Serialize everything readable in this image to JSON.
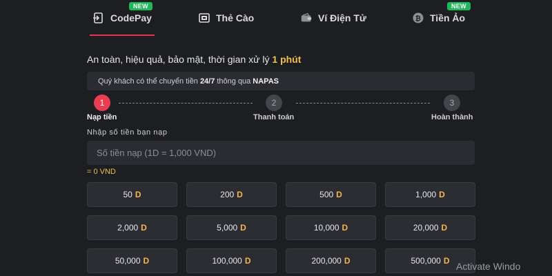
{
  "tabs": [
    {
      "label": "CodePay",
      "icon": "codepay-icon",
      "badge": "NEW",
      "active": true
    },
    {
      "label": "Thẻ Cào",
      "icon": "card-icon",
      "badge": "",
      "active": false
    },
    {
      "label": "Ví Điện Tử",
      "icon": "wallet-icon",
      "badge": "",
      "active": false
    },
    {
      "label": "Tiền Ảo",
      "icon": "bitcoin-icon",
      "badge": "NEW",
      "active": false
    }
  ],
  "headline": {
    "text": "An toàn, hiệu quả, bảo mật, thời gian xử lý",
    "highlight": "1 phút"
  },
  "notice": {
    "prefix": "Quý khách có thể chuyển tiền",
    "bold1": "24/7",
    "middle": "thông qua",
    "bold2": "NAPAS"
  },
  "steps": [
    {
      "number": "1",
      "label": "Nạp tiền",
      "active": true
    },
    {
      "number": "2",
      "label": "Thanh toán",
      "active": false
    },
    {
      "number": "3",
      "label": "Hoàn thành",
      "active": false
    }
  ],
  "form": {
    "label": "Nhập số tiền bạn nạp",
    "placeholder": "Số tiền nạp (1D = 1,000 VND)",
    "value": "",
    "converted": "= 0 VND"
  },
  "amounts": [
    {
      "value": "50",
      "unit": "D"
    },
    {
      "value": "200",
      "unit": "D"
    },
    {
      "value": "500",
      "unit": "D"
    },
    {
      "value": "1,000",
      "unit": "D"
    },
    {
      "value": "2,000",
      "unit": "D"
    },
    {
      "value": "5,000",
      "unit": "D"
    },
    {
      "value": "10,000",
      "unit": "D"
    },
    {
      "value": "20,000",
      "unit": "D"
    },
    {
      "value": "50,000",
      "unit": "D"
    },
    {
      "value": "100,000",
      "unit": "D"
    },
    {
      "value": "200,000",
      "unit": "D"
    },
    {
      "value": "500,000",
      "unit": "D"
    }
  ],
  "watermark": "Activate Windo",
  "colors": {
    "accent": "#ea3d54",
    "highlight": "#f2c14e",
    "badge": "#1fb85a",
    "background": "#1d1e22"
  }
}
